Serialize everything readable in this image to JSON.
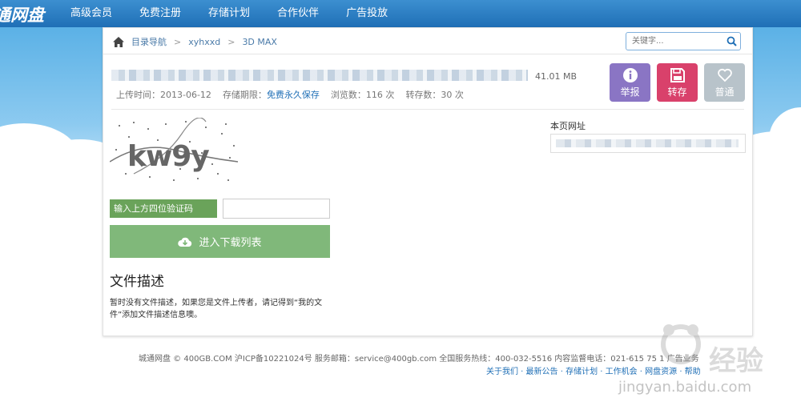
{
  "site": {
    "logo": "通网盘"
  },
  "nav": [
    "高级会员",
    "免费注册",
    "存储计划",
    "合作伙伴",
    "广告投放"
  ],
  "breadcrumb": {
    "items": [
      "目录导航",
      "xyhxxd",
      "3D MAX"
    ],
    "separator": ">"
  },
  "search": {
    "placeholder": "关键字..."
  },
  "file": {
    "size": "41.01 MB",
    "upload_time": "上传时间：2013-06-12",
    "storage_label": "存储期限：",
    "storage_value": "免费永久保存",
    "views": "浏览数：116 次",
    "saves": "转存数：30 次"
  },
  "actions": [
    {
      "label": "举报",
      "icon": "info-icon",
      "color": "#8a75c4"
    },
    {
      "label": "转存",
      "icon": "save-icon",
      "color": "#d9416b"
    },
    {
      "label": "普通",
      "icon": "heart-icon",
      "color": "#b8c3ca"
    }
  ],
  "captcha": {
    "text": "kw9y"
  },
  "verify": {
    "label": "输入上方四位验证码",
    "value": ""
  },
  "download": {
    "label": "进入下载列表"
  },
  "description": {
    "title": "文件描述",
    "text": "暂时没有文件描述，如果您是文件上传者，请记得到“我的文件”添加文件描述信息噢。"
  },
  "page_url": {
    "label": "本页网址"
  },
  "footer": {
    "line1": "城通网盘 © 400GB.COM  沪ICP备10221024号  服务邮箱：service@400gb.com  全国服务热线：400-032-5516  内容监督电话：021-615  75  1  广告业务",
    "line2": "关于我们 · 最新公告 · 存储计划 · 工作机会 · 网盘资源 · 帮助"
  },
  "watermark": {
    "text": "jingyan.baidu.com"
  }
}
